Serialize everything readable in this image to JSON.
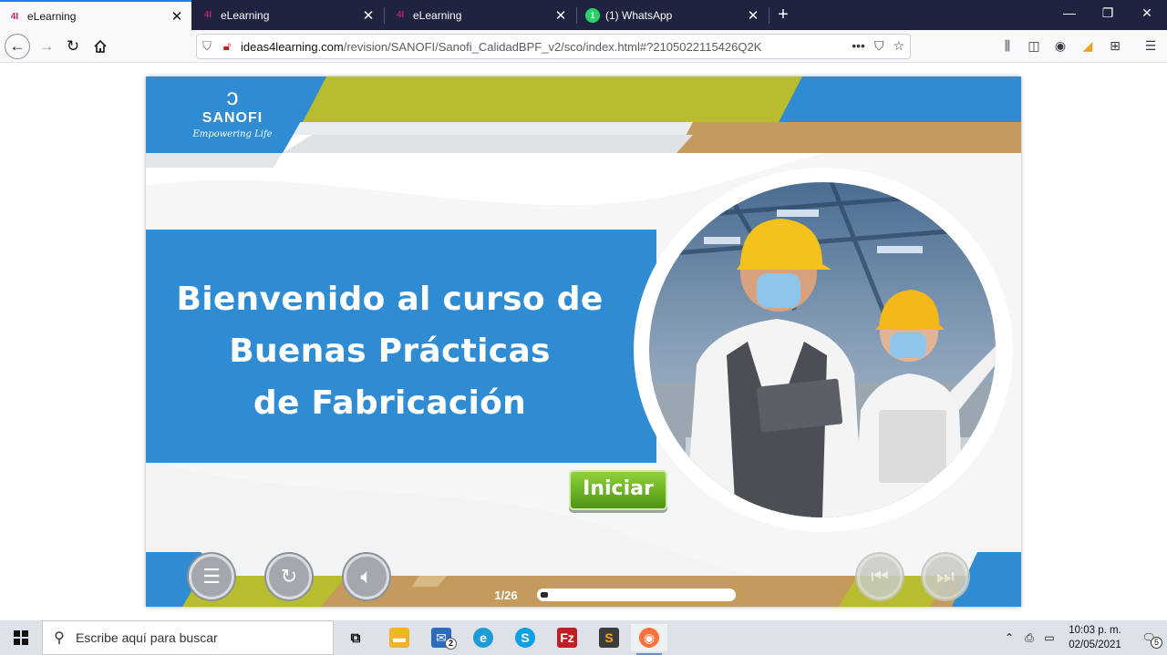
{
  "browser": {
    "tabs": [
      {
        "title": "eLearning",
        "favicon": "4I",
        "active": true
      },
      {
        "title": "eLearning",
        "favicon": "4I",
        "active": false
      },
      {
        "title": "eLearning",
        "favicon": "4I",
        "active": false
      },
      {
        "title": "(1) WhatsApp",
        "favicon": "whatsapp-icon",
        "active": false
      }
    ],
    "url_domain": "ideas4learning.com",
    "url_path": "/revision/SANOFI/Sanofi_CalidadBPF_v2/sco/index.html#?2105022115426Q2K",
    "url_more": "•••"
  },
  "course": {
    "logo_name": "SANOFI",
    "logo_tagline": "Empowering Life",
    "title_lines": [
      "Bienvenido al curso de",
      "Buenas Prácticas",
      "de Fabricación"
    ],
    "start_label": "Iniciar",
    "page_indicator": "1/26",
    "progress_fraction": 0.04
  },
  "colors": {
    "brand_blue": "#2f8bd2",
    "lime": "#b8bc2f",
    "tan": "#c49a5d",
    "start_green": "#6cb525"
  },
  "taskbar": {
    "search_placeholder": "Escribe aquí para buscar",
    "mail_badge": "2",
    "clock_time": "10:03 p. m.",
    "clock_date": "02/05/2021",
    "notification_count": "5"
  }
}
